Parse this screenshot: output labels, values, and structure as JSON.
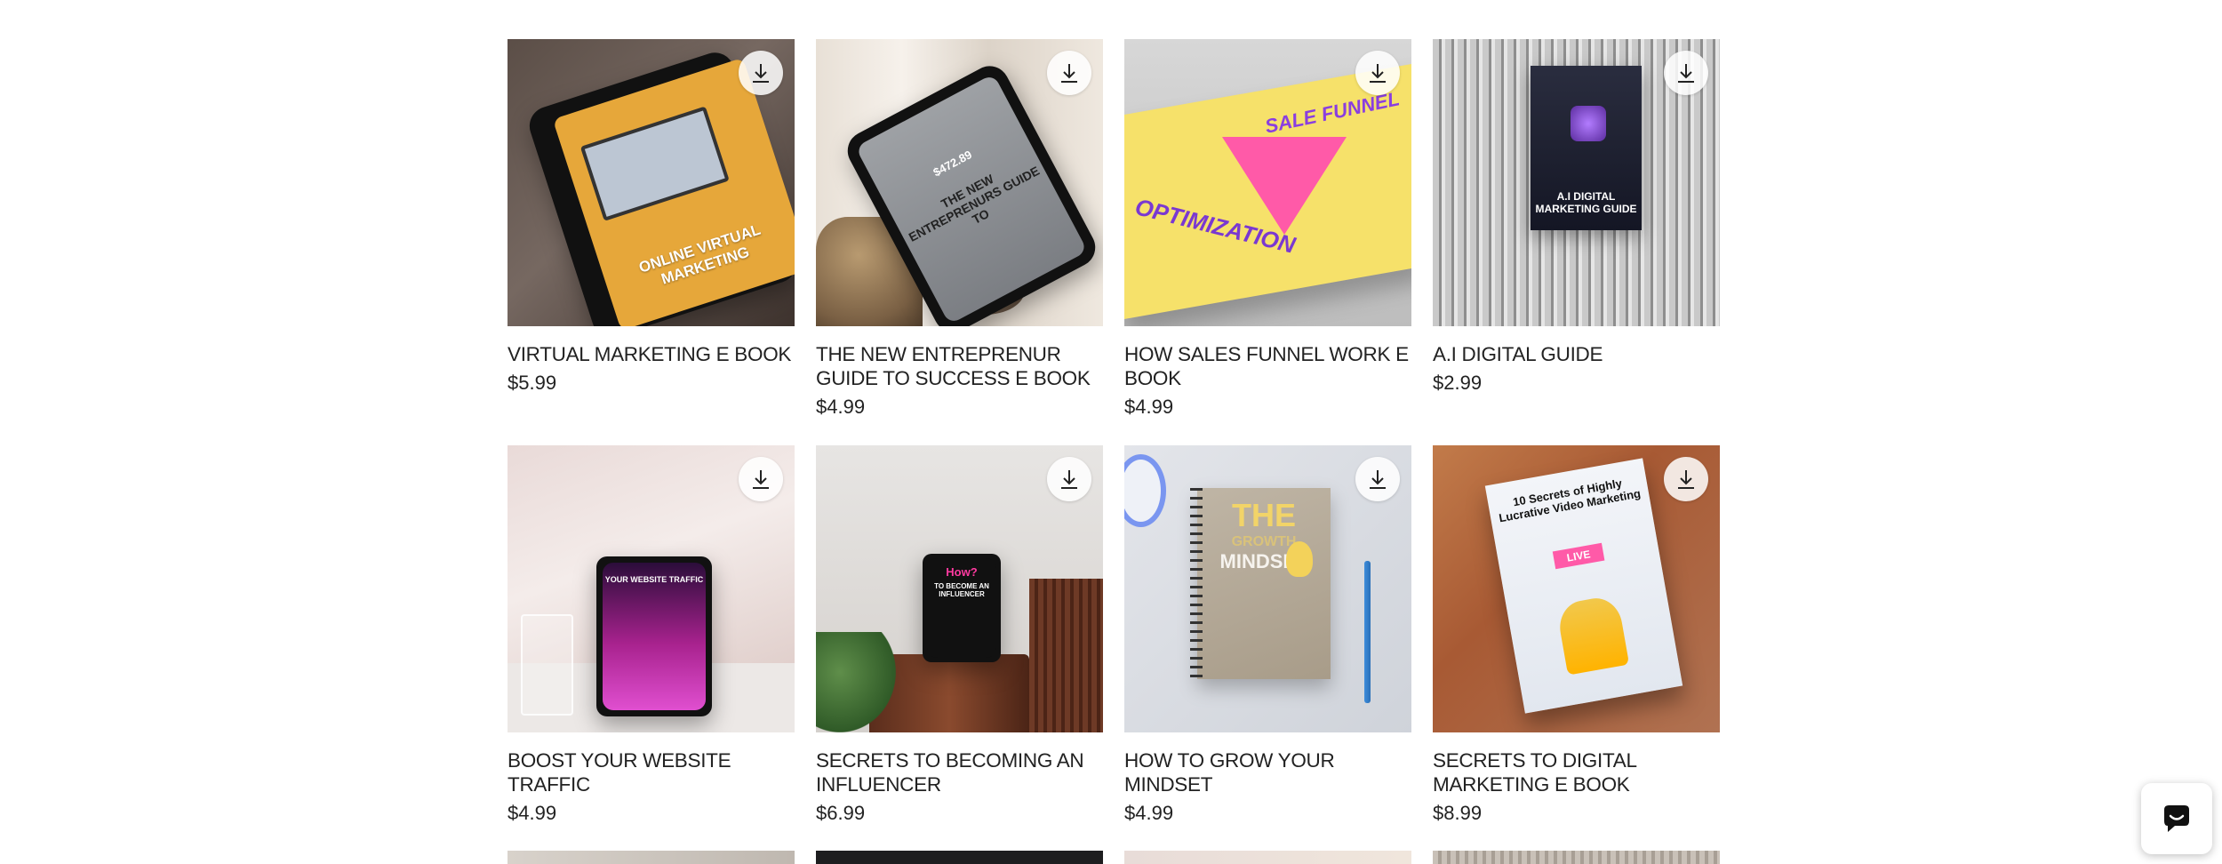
{
  "products": [
    {
      "title": "VIRTUAL MARKETING E BOOK",
      "price": "$5.99",
      "cover_text": "ONLINE VIRTUAL MARKETING"
    },
    {
      "title": "THE NEW ENTREPRENUR GUIDE TO SUCCESS E BOOK",
      "price": "$4.99",
      "cover_text": "THE NEW ENTREPRENURS GUIDE TO",
      "cover_amount": "$472.89"
    },
    {
      "title": "HOW SALES FUNNEL WORK E BOOK",
      "price": "$4.99",
      "cover_top": "SALE FUNNEL",
      "cover_bottom": "OPTIMIZATION"
    },
    {
      "title": "A.I DIGITAL GUIDE",
      "price": "$2.99",
      "cover_text": "A.I DIGITAL MARKETING GUIDE"
    },
    {
      "title": "BOOST YOUR WEBSITE TRAFFIC",
      "price": "$4.99",
      "cover_text": "YOUR WEBSITE TRAFFIC"
    },
    {
      "title": "SECRETS TO BECOMING AN INFLUENCER",
      "price": "$6.99",
      "cover_text_1": "How?",
      "cover_text_2": "TO BECOME AN INFLUENCER"
    },
    {
      "title": "HOW TO GROW YOUR MINDSET",
      "price": "$4.99",
      "cover_text_1": "THE",
      "cover_text_2": "GROWTH",
      "cover_text_3": "MINDSET"
    },
    {
      "title": "SECRETS TO DIGITAL MARKETING E BOOK",
      "price": "$8.99",
      "cover_text": "10 Secrets of Highly Lucrative Video Marketing",
      "cover_badge": "LIVE"
    }
  ],
  "icons": {
    "download": "download-icon",
    "chat": "chat-icon"
  },
  "colors": {
    "text": "#222222",
    "background": "#ffffff"
  }
}
